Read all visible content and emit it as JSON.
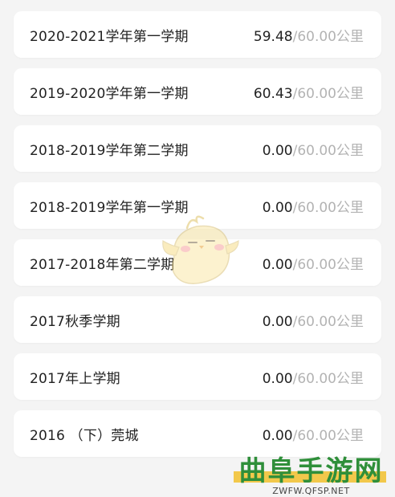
{
  "records": [
    {
      "term": "2020-2021学年第一学期",
      "done": "59.48",
      "sep": "/",
      "goal": "60.00",
      "unit": "公里"
    },
    {
      "term": "2019-2020学年第一学期",
      "done": "60.43",
      "sep": "/",
      "goal": "60.00",
      "unit": "公里"
    },
    {
      "term": "2018-2019学年第二学期",
      "done": "0.00",
      "sep": "/",
      "goal": "60.00",
      "unit": "公里"
    },
    {
      "term": "2018-2019学年第一学期",
      "done": "0.00",
      "sep": "/",
      "goal": "60.00",
      "unit": "公里"
    },
    {
      "term": "2017-2018年第二学期",
      "done": "0.00",
      "sep": "/",
      "goal": "60.00",
      "unit": "公里"
    },
    {
      "term": "2017秋季学期",
      "done": "0.00",
      "sep": "/",
      "goal": "60.00",
      "unit": "公里"
    },
    {
      "term": "2017年上学期",
      "done": "0.00",
      "sep": "/",
      "goal": "60.00",
      "unit": "公里"
    },
    {
      "term": "2016 （下）莞城",
      "done": "0.00",
      "sep": "/",
      "goal": "60.00",
      "unit": "公里"
    }
  ],
  "watermark": {
    "title": "曲阜手游网",
    "url": "ZWFW.QFSP.NET"
  },
  "mascot": {
    "icon": "chick-mascot-icon"
  },
  "colors": {
    "background": "#f4f4f4",
    "card": "#ffffff",
    "primary_text": "#222222",
    "muted_text": "#b3b3b3",
    "watermark_green": "#2f8f3a",
    "watermark_yellow": "#f2c84b"
  }
}
